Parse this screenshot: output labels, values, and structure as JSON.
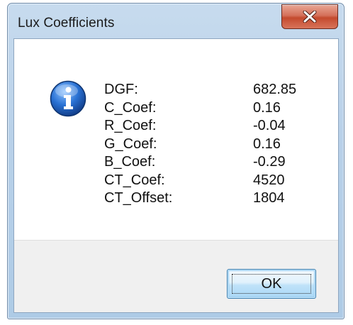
{
  "window": {
    "title": "Lux Coefficients"
  },
  "icons": {
    "info": "information-icon",
    "close": "close-icon"
  },
  "coefficients": [
    {
      "label": "DGF:",
      "value": "682.85"
    },
    {
      "label": "C_Coef:",
      "value": "0.16"
    },
    {
      "label": "R_Coef:",
      "value": "-0.04"
    },
    {
      "label": "G_Coef:",
      "value": "0.16"
    },
    {
      "label": "B_Coef:",
      "value": "-0.29"
    },
    {
      "label": "CT_Coef:",
      "value": "4520"
    },
    {
      "label": "CT_Offset:",
      "value": "1804"
    }
  ],
  "buttons": {
    "ok_label": "OK"
  },
  "colors": {
    "close_button": "#c44a2e",
    "info_icon": "#1c5fb8",
    "ok_button": "#bfe2f9"
  }
}
